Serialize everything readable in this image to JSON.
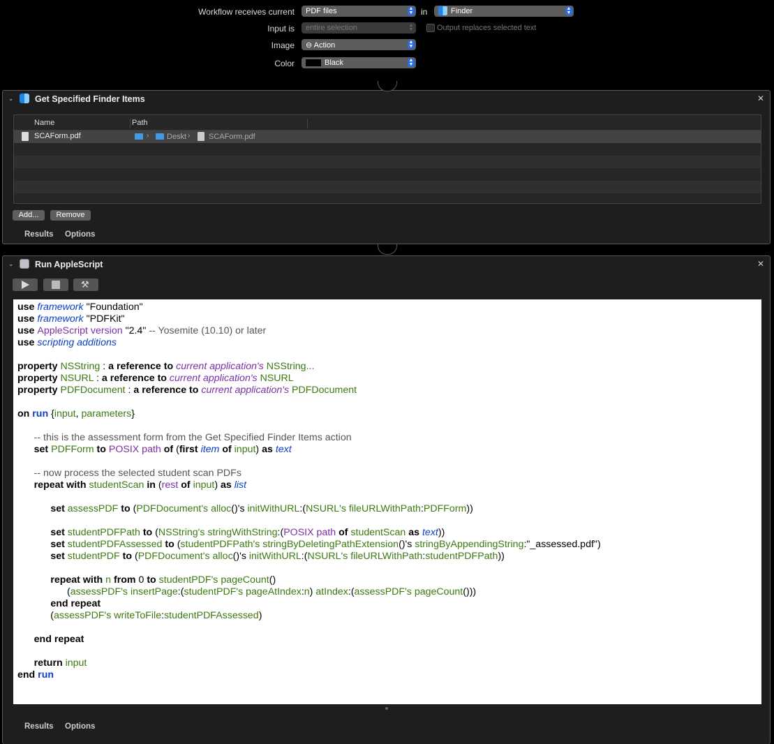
{
  "settings": {
    "receives_label": "Workflow receives current",
    "receives_value": "PDF files",
    "in_label": "in",
    "in_value": "Finder",
    "input_is_label": "Input is",
    "input_is_value": "entire selection",
    "output_replaces_label": "Output replaces selected text",
    "image_label": "Image",
    "image_value": "⊖ Action",
    "color_label": "Color",
    "color_value": "Black",
    "color_swatch": "#000000"
  },
  "finder_action": {
    "title": "Get Specified Finder Items",
    "columns": [
      "Name",
      "Path"
    ],
    "rows": [
      {
        "name": "SCAForm.pdf",
        "path": [
          "Deskt",
          "SCAForm.pdf"
        ]
      }
    ],
    "add_label": "Add...",
    "remove_label": "Remove",
    "results_label": "Results",
    "options_label": "Options"
  },
  "script_action": {
    "title": "Run AppleScript",
    "results_label": "Results",
    "options_label": "Options"
  },
  "code_lines": [
    [
      [
        "kw",
        "use "
      ],
      [
        "te",
        "framework"
      ],
      [
        "st",
        " \"Foundation\""
      ]
    ],
    [
      [
        "kw",
        "use "
      ],
      [
        "te",
        "framework"
      ],
      [
        "st",
        " \"PDFKit\""
      ]
    ],
    [
      [
        "kw",
        "use "
      ],
      [
        "ap",
        "AppleScript version"
      ],
      [
        "st",
        " \"2.4\" "
      ],
      [
        "co",
        "-- Yosemite (10.10) or later"
      ]
    ],
    [
      [
        "kw",
        "use "
      ],
      [
        "te",
        "scripting additions"
      ]
    ],
    [],
    [
      [
        "kw",
        "property "
      ],
      [
        "va",
        "NSString"
      ],
      [
        "st",
        " : "
      ],
      [
        "kw",
        "a reference to "
      ],
      [
        "ai",
        "current application's"
      ],
      [
        "va",
        " NSString"
      ],
      [
        "co",
        "..."
      ]
    ],
    [
      [
        "kw",
        "property "
      ],
      [
        "va",
        "NSURL"
      ],
      [
        "st",
        " : "
      ],
      [
        "kw",
        "a reference to "
      ],
      [
        "ai",
        "current application's"
      ],
      [
        "va",
        " NSURL"
      ]
    ],
    [
      [
        "kw",
        "property "
      ],
      [
        "va",
        "PDFDocument"
      ],
      [
        "st",
        " : "
      ],
      [
        "kw",
        "a reference to "
      ],
      [
        "ai",
        "current application's"
      ],
      [
        "va",
        " PDFDocument"
      ]
    ],
    [],
    [
      [
        "kw",
        "on "
      ],
      [
        "kb",
        "run"
      ],
      [
        "st",
        " {"
      ],
      [
        "va",
        "input"
      ],
      [
        "st",
        ", "
      ],
      [
        "va",
        "parameters"
      ],
      [
        "st",
        "}"
      ]
    ],
    [],
    [
      [
        "co",
        "      -- this is the assessment form from the Get Specified Finder Items action"
      ]
    ],
    [
      [
        "st",
        "      "
      ],
      [
        "kw",
        "set "
      ],
      [
        "va",
        "PDFForm"
      ],
      [
        "kw",
        " to "
      ],
      [
        "ap",
        "POSIX path"
      ],
      [
        "kw",
        " of "
      ],
      [
        "st",
        "("
      ],
      [
        "kw",
        "first "
      ],
      [
        "te",
        "item"
      ],
      [
        "kw",
        " of "
      ],
      [
        "va",
        "input"
      ],
      [
        "st",
        ") "
      ],
      [
        "kw",
        "as "
      ],
      [
        "te",
        "text"
      ]
    ],
    [],
    [
      [
        "co",
        "      -- now process the selected student scan PDFs"
      ]
    ],
    [
      [
        "st",
        "      "
      ],
      [
        "kw",
        "repeat with "
      ],
      [
        "va",
        "studentScan"
      ],
      [
        "kw",
        " in "
      ],
      [
        "st",
        "("
      ],
      [
        "ap",
        "rest"
      ],
      [
        "kw",
        " of "
      ],
      [
        "va",
        "input"
      ],
      [
        "st",
        ") "
      ],
      [
        "kw",
        "as "
      ],
      [
        "te",
        "list"
      ]
    ],
    [],
    [
      [
        "st",
        "            "
      ],
      [
        "kw",
        "set "
      ],
      [
        "va",
        "assessPDF"
      ],
      [
        "kw",
        " to "
      ],
      [
        "st",
        "("
      ],
      [
        "va",
        "PDFDocument's alloc"
      ],
      [
        "st",
        "()'s "
      ],
      [
        "va",
        "initWithURL"
      ],
      [
        "st",
        ":("
      ],
      [
        "va",
        "NSURL's fileURLWithPath"
      ],
      [
        "st",
        ":"
      ],
      [
        "va",
        "PDFForm"
      ],
      [
        "st",
        "))"
      ]
    ],
    [],
    [
      [
        "st",
        "            "
      ],
      [
        "kw",
        "set "
      ],
      [
        "va",
        "studentPDFPath"
      ],
      [
        "kw",
        " to "
      ],
      [
        "st",
        "("
      ],
      [
        "va",
        "NSString's stringWithString"
      ],
      [
        "st",
        ":("
      ],
      [
        "ap",
        "POSIX path"
      ],
      [
        "kw",
        " of "
      ],
      [
        "va",
        "studentScan"
      ],
      [
        "kw",
        " as "
      ],
      [
        "te",
        "text"
      ],
      [
        "st",
        "))"
      ]
    ],
    [
      [
        "st",
        "            "
      ],
      [
        "kw",
        "set "
      ],
      [
        "va",
        "studentPDFAssessed"
      ],
      [
        "kw",
        " to "
      ],
      [
        "st",
        "("
      ],
      [
        "va",
        "studentPDFPath's stringByDeletingPathExtension"
      ],
      [
        "st",
        "()'s "
      ],
      [
        "va",
        "stringByAppendingString"
      ],
      [
        "st",
        ":\"_assessed.pdf\")"
      ]
    ],
    [
      [
        "st",
        "            "
      ],
      [
        "kw",
        "set "
      ],
      [
        "va",
        "studentPDF"
      ],
      [
        "kw",
        " to "
      ],
      [
        "st",
        "("
      ],
      [
        "va",
        "PDFDocument's alloc"
      ],
      [
        "st",
        "()'s "
      ],
      [
        "va",
        "initWithURL"
      ],
      [
        "st",
        ":("
      ],
      [
        "va",
        "NSURL's fileURLWithPath"
      ],
      [
        "st",
        ":"
      ],
      [
        "va",
        "studentPDFPath"
      ],
      [
        "st",
        "))"
      ]
    ],
    [],
    [
      [
        "st",
        "            "
      ],
      [
        "kw",
        "repeat with "
      ],
      [
        "va",
        "n"
      ],
      [
        "kw",
        " from "
      ],
      [
        "st",
        "0 "
      ],
      [
        "kw",
        "to "
      ],
      [
        "va",
        "studentPDF's pageCount"
      ],
      [
        "st",
        "()"
      ]
    ],
    [
      [
        "st",
        "                  ("
      ],
      [
        "va",
        "assessPDF's insertPage"
      ],
      [
        "st",
        ":("
      ],
      [
        "va",
        "studentPDF's pageAtIndex"
      ],
      [
        "st",
        ":"
      ],
      [
        "va",
        "n"
      ],
      [
        "st",
        ") "
      ],
      [
        "va",
        "atIndex"
      ],
      [
        "st",
        ":("
      ],
      [
        "va",
        "assessPDF's pageCount"
      ],
      [
        "st",
        "()))"
      ]
    ],
    [
      [
        "st",
        "            "
      ],
      [
        "kw",
        "end repeat"
      ]
    ],
    [
      [
        "st",
        "            ("
      ],
      [
        "va",
        "assessPDF's writeToFile"
      ],
      [
        "st",
        ":"
      ],
      [
        "va",
        "studentPDFAssessed"
      ],
      [
        "st",
        ")"
      ]
    ],
    [],
    [
      [
        "st",
        "      "
      ],
      [
        "kw",
        "end repeat"
      ]
    ],
    [],
    [
      [
        "st",
        "      "
      ],
      [
        "kw",
        "return "
      ],
      [
        "va",
        "input"
      ]
    ],
    [
      [
        "kw",
        "end "
      ],
      [
        "kb",
        "run"
      ]
    ]
  ]
}
